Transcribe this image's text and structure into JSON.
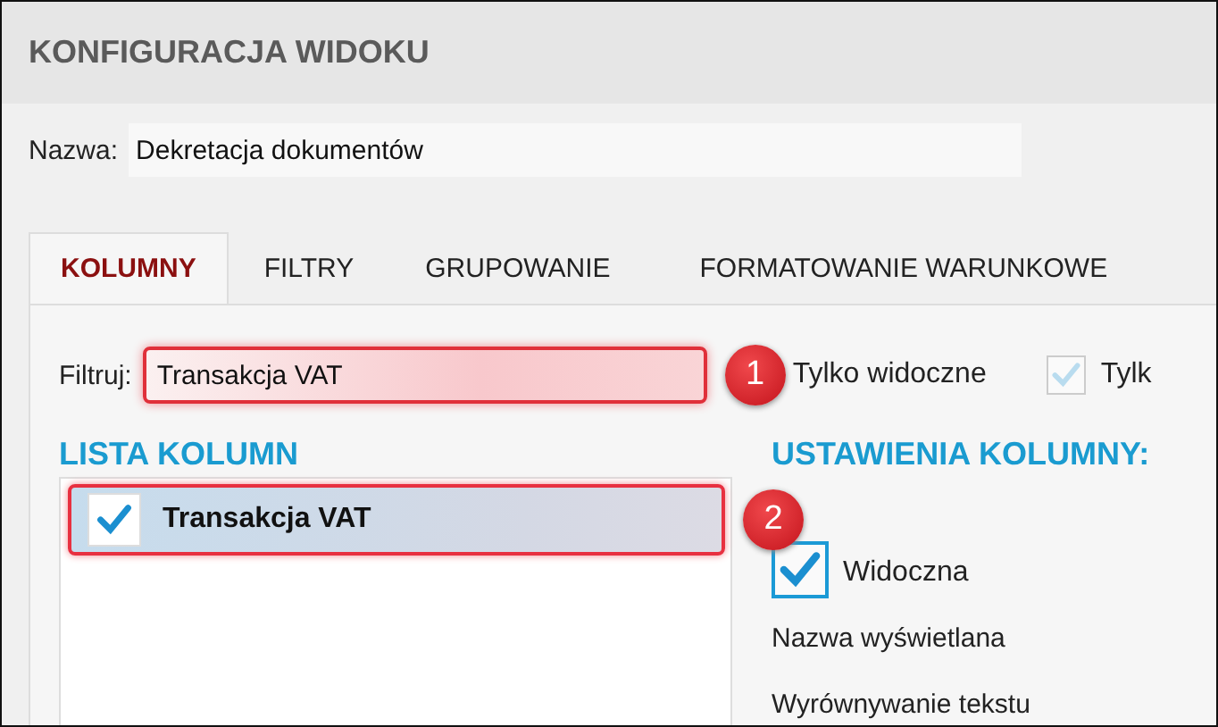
{
  "title": "KONFIGURACJA WIDOKU",
  "name_field": {
    "label": "Nazwa:",
    "value": "Dekretacja dokumentów"
  },
  "tabs": [
    {
      "label": "KOLUMNY",
      "selected": true
    },
    {
      "label": "FILTRY",
      "selected": false
    },
    {
      "label": "GRUPOWANIE",
      "selected": false
    },
    {
      "label": "FORMATOWANIE WARUNKOWE",
      "selected": false
    }
  ],
  "filter": {
    "label": "Filtruj:",
    "value": "Transakcja VAT",
    "callout": "1"
  },
  "options": [
    {
      "label": "Tylko widoczne"
    },
    {
      "label": "Tylk",
      "checked": true,
      "disabled": true
    }
  ],
  "column_list": {
    "title": "LISTA KOLUMN",
    "items": [
      {
        "name": "Transakcja VAT",
        "checked": true,
        "selected": true,
        "callout": "2"
      }
    ]
  },
  "column_settings": {
    "title": "USTAWIENIA KOLUMNY:",
    "visible": {
      "label": "Widoczna",
      "checked": true
    },
    "fields": [
      "Nazwa wyświetlana",
      "Wyrównywanie tekstu"
    ]
  }
}
